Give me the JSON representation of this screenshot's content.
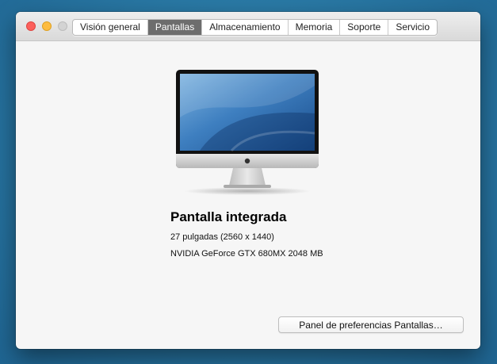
{
  "tabs": [
    {
      "label": "Visión general",
      "active": false
    },
    {
      "label": "Pantallas",
      "active": true
    },
    {
      "label": "Almacenamiento",
      "active": false
    },
    {
      "label": "Memoria",
      "active": false
    },
    {
      "label": "Soporte",
      "active": false
    },
    {
      "label": "Servicio",
      "active": false
    }
  ],
  "display": {
    "name": "Pantalla integrada",
    "size": "27 pulgadas (2560 x 1440)",
    "graphics": "NVIDIA GeForce GTX 680MX 2048 MB"
  },
  "buttons": {
    "prefs": "Panel de preferencias Pantallas…"
  }
}
